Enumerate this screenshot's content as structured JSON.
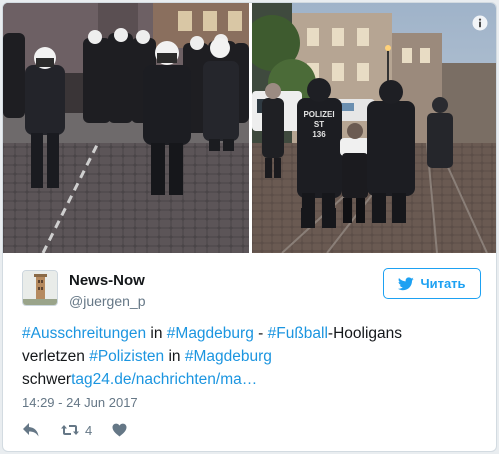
{
  "tweet": {
    "author": {
      "name": "News-Now",
      "handle": "@juergen_p"
    },
    "follow_label": "Читать",
    "text": {
      "line1": [
        {
          "t": "#Ausschreitungen",
          "kind": "ht"
        },
        {
          "t": " in ",
          "kind": "plain"
        },
        {
          "t": "#Magdeburg",
          "kind": "ht"
        },
        {
          "t": " - ",
          "kind": "plain"
        },
        {
          "t": "#Fußball",
          "kind": "ht"
        },
        {
          "t": "-Hooligans",
          "kind": "plain"
        }
      ],
      "line2": [
        {
          "t": "verletzen ",
          "kind": "plain"
        },
        {
          "t": "#Polizisten",
          "kind": "ht"
        },
        {
          "t": " in ",
          "kind": "plain"
        },
        {
          "t": "#Magdeburg",
          "kind": "ht"
        }
      ],
      "line3": [
        {
          "t": "schwer",
          "kind": "plain"
        },
        {
          "t": "tag24.de/nachrichten/ma…",
          "kind": "lnk"
        }
      ]
    },
    "timestamp": "14:29 - 24 Jun 2017",
    "retweet_count": "4",
    "photo_right_vest_text": {
      "line1": "POLIZEI",
      "line2": "ST",
      "line3": "136"
    }
  },
  "colors": {
    "link": "#1b95e0",
    "text": "#14171a",
    "muted": "#657786",
    "follow": "#1da1f2"
  },
  "icons": {
    "info": "info-icon",
    "reply": "reply-icon",
    "retweet": "retweet-icon",
    "like": "heart-icon",
    "follow_bird": "twitter-bird-icon"
  }
}
